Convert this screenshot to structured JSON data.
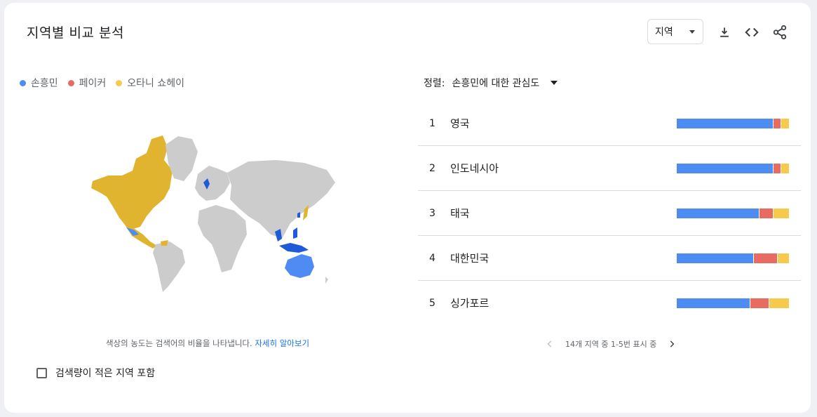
{
  "title": "지역별 비교 분석",
  "region_select": {
    "value": "지역"
  },
  "icons": [
    "download-icon",
    "embed-icon",
    "share-icon"
  ],
  "legend": [
    {
      "label": "손흥민",
      "color": "#4e8cf4"
    },
    {
      "label": "페이커",
      "color": "#e86b62"
    },
    {
      "label": "오타니 쇼헤이",
      "color": "#f7ca4d"
    }
  ],
  "map": {
    "map_colors": {
      "base": "#cccccc",
      "americas": "#e0b42f",
      "asia_blue": "#4e8cf4",
      "dark_blue": "#1f5bd8"
    }
  },
  "map_note": {
    "text": "색상의 농도는 검색어의 비율을 나타냅니다. ",
    "link": "자세히 알아보기"
  },
  "low_volume": {
    "label": "검색량이 적은 지역 포함",
    "checked": false
  },
  "sort": {
    "label": "정렬:",
    "value": "손흥민에 대한 관심도"
  },
  "rows": [
    {
      "rank": "1",
      "name": "영국",
      "shares": [
        0.87,
        0.06,
        0.07
      ]
    },
    {
      "rank": "2",
      "name": "인도네시아",
      "shares": [
        0.87,
        0.06,
        0.07
      ]
    },
    {
      "rank": "3",
      "name": "태국",
      "shares": [
        0.74,
        0.12,
        0.14
      ]
    },
    {
      "rank": "4",
      "name": "대한민국",
      "shares": [
        0.69,
        0.21,
        0.1
      ]
    },
    {
      "rank": "5",
      "name": "싱가포르",
      "shares": [
        0.66,
        0.16,
        0.18
      ]
    }
  ],
  "pager": {
    "text": "14개 지역 중 1-5번 표시 중"
  }
}
